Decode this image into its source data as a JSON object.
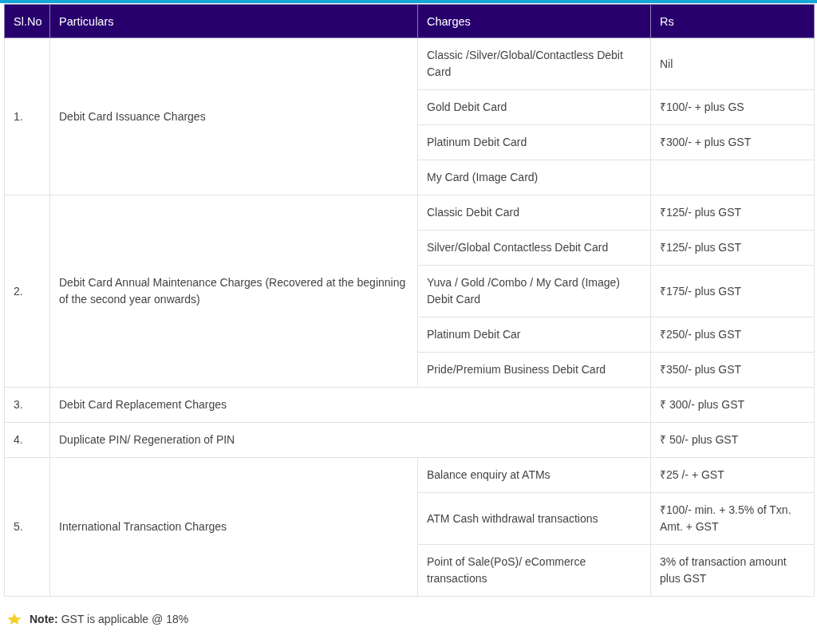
{
  "table": {
    "columns": [
      "Sl.No",
      "Particulars",
      "Charges",
      "Rs"
    ],
    "rows": [
      {
        "sl": "1.",
        "particular": "Debit Card Issuance Charges",
        "items": [
          {
            "charge": "Classic /Silver/Global/Contactless Debit Card",
            "rs": "Nil"
          },
          {
            "charge": "Gold Debit Card",
            "rs": "₹100/- + plus GS"
          },
          {
            "charge": "Platinum Debit Card",
            "rs": "₹300/- + plus GST"
          },
          {
            "charge": "My Card (Image Card)"
          }
        ]
      },
      {
        "sl": "2.",
        "particular": "Debit Card Annual Maintenance Charges (Recovered at the beginning of the second year onwards)",
        "items": [
          {
            "charge": "Classic Debit Card",
            "rs": "₹125/- plus GST"
          },
          {
            "charge": "Silver/Global Contactless Debit Card",
            "rs": "₹125/- plus GST"
          },
          {
            "charge": "Yuva / Gold /Combo / My Card (Image) Debit Card",
            "rs": "₹175/- plus GST"
          },
          {
            "charge": "Platinum Debit Car",
            "rs": "₹250/- plus GST"
          },
          {
            "charge": "Pride/Premium Business Debit Card",
            "rs": "₹350/- plus GST"
          }
        ]
      },
      {
        "sl": "3.",
        "particular": "Debit Card Replacement Charges",
        "rs": "₹ 300/- plus GST"
      },
      {
        "sl": "4.",
        "particular": "Duplicate PIN/ Regeneration of PIN",
        "rs": "₹ 50/- plus GST"
      },
      {
        "sl": "5.",
        "particular": "International Transaction Charges",
        "items": [
          {
            "charge": "Balance enquiry at ATMs",
            "rs": "₹25 /- + GST"
          },
          {
            "charge": "ATM Cash withdrawal transactions",
            "rs": "₹100/- min. + 3.5% of Txn. Amt. + GST"
          },
          {
            "charge": "Point of Sale(PoS)/ eCommerce transactions",
            "rs": "3% of transaction amount plus GST"
          }
        ]
      }
    ]
  },
  "note": "**Note:** GST is applicable @ 18%"
}
